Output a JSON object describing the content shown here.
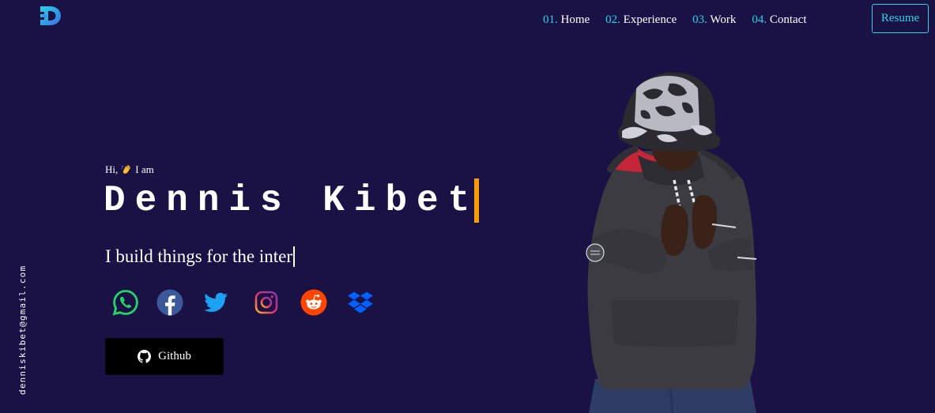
{
  "logo": {
    "letter": "D",
    "icon": "d-logo-icon",
    "gradient": [
      "#2ad3e8",
      "#3b6fe0"
    ]
  },
  "nav": {
    "items": [
      {
        "num": "01.",
        "label": "Home"
      },
      {
        "num": "02.",
        "label": "Experience"
      },
      {
        "num": "03.",
        "label": "Work"
      },
      {
        "num": "04.",
        "label": "Contact"
      }
    ],
    "resume_label": "Resume"
  },
  "side": {
    "email": "denniskibet@gmail.com"
  },
  "hero": {
    "greeting_pre": "Hi,",
    "greeting_post": "I am",
    "greeting_icon": "waving-hand-icon",
    "name": "Dennis Kibet",
    "tagline": "I build things for the inter"
  },
  "socials": [
    {
      "name": "whatsapp-icon",
      "color": "#25d366"
    },
    {
      "name": "facebook-icon",
      "color": "#3b5998"
    },
    {
      "name": "twitter-icon",
      "color": "#1da1f2"
    },
    {
      "name": "instagram-icon",
      "color": "#d6249f"
    },
    {
      "name": "reddit-icon",
      "color": "#ff4500"
    },
    {
      "name": "dropbox-icon",
      "color": "#0061ff"
    }
  ],
  "github": {
    "label": "Github",
    "icon": "github-icon"
  },
  "colors": {
    "background": "#1a1145",
    "accent": "#2ad3e8",
    "cursor": "#f5a00a",
    "button_bg": "#000000"
  }
}
